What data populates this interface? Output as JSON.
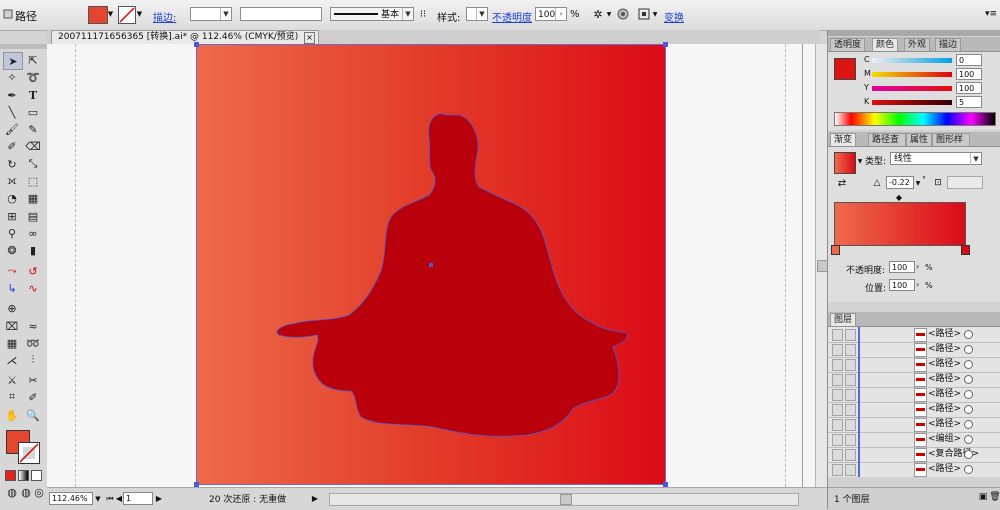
{
  "control_bar": {
    "object_type": "路径",
    "stroke_link": "描边:",
    "stroke_profile": "基本",
    "style_label": "样式:",
    "opacity_link": "不透明度",
    "opacity_value": "100",
    "opacity_unit": "%",
    "transform_link": "变换"
  },
  "document": {
    "tab_title": "20071117165636​5 [转换].ai* @ 112.46% (CMYK/预览)"
  },
  "status_bar": {
    "zoom": "112.46%",
    "page": "1",
    "status_text": "20 次还原 : 无重做"
  },
  "color_panel": {
    "tabs": [
      "透明度",
      "颜色",
      "外观",
      "描边"
    ],
    "active_tab": "颜色",
    "channels": [
      {
        "label": "C",
        "value": "0"
      },
      {
        "label": "M",
        "value": "100"
      },
      {
        "label": "Y",
        "value": "100"
      },
      {
        "label": "K",
        "value": "5"
      }
    ],
    "swatch_color": "#dd1414"
  },
  "gradient_panel": {
    "tabs": [
      "渐变",
      "路径查找",
      "属性",
      "图形样式"
    ],
    "active_tab": "渐变",
    "type_label": "类型:",
    "type_value": "线性",
    "angle_value": "-0.22",
    "opacity_label": "不透明度:",
    "opacity_value": "100",
    "position_label": "位置:",
    "position_value": "100",
    "unit": "%",
    "start_color": "#ee6a4a",
    "end_color": "#db0a18"
  },
  "layers_panel": {
    "title": "图层",
    "rows": [
      "<路径>",
      "<路径>",
      "<路径>",
      "<路径>",
      "<路径>",
      "<路径>",
      "<路径>",
      "<编组>",
      "<复合路径>",
      "<路径>"
    ],
    "footer": "1 个图层"
  },
  "colors": {
    "accent": "#dd1414",
    "silhouette": "#b9000b",
    "selection": "#4b5bd6"
  }
}
